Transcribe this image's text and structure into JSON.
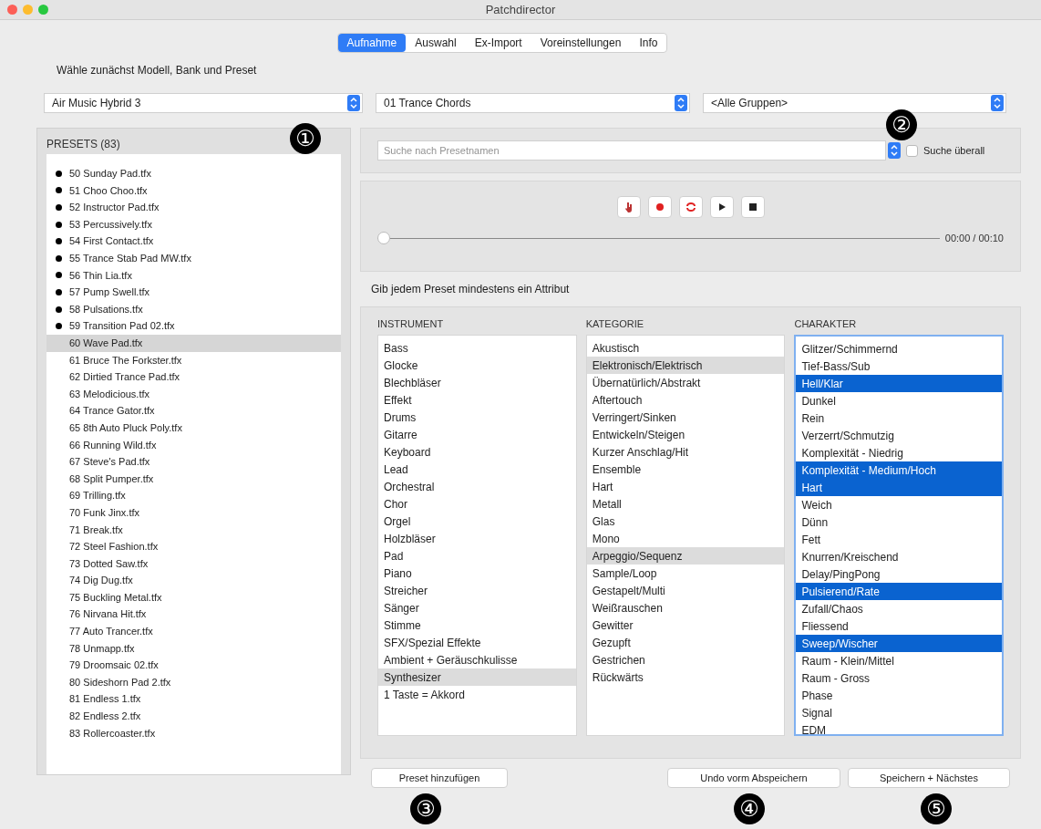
{
  "window": {
    "title": "Patchdirector"
  },
  "tabs": [
    {
      "label": "Aufnahme",
      "selected": true
    },
    {
      "label": "Auswahl",
      "selected": false
    },
    {
      "label": "Ex-Import",
      "selected": false
    },
    {
      "label": "Voreinstellungen",
      "selected": false
    },
    {
      "label": "Info",
      "selected": false
    }
  ],
  "instruction": "Wähle zunächst Modell, Bank und Preset",
  "selectors": [
    "Air Music Hybrid 3",
    "01 Trance Chords",
    "<Alle Gruppen>"
  ],
  "presets": {
    "title": "PRESETS (83)",
    "items": [
      {
        "label": "50 Sunday Pad.tfx",
        "marked": true,
        "selected": false
      },
      {
        "label": "51 Choo Choo.tfx",
        "marked": true,
        "selected": false
      },
      {
        "label": "52 Instructor Pad.tfx",
        "marked": true,
        "selected": false
      },
      {
        "label": "53 Percussively.tfx",
        "marked": true,
        "selected": false
      },
      {
        "label": "54 First Contact.tfx",
        "marked": true,
        "selected": false
      },
      {
        "label": "55 Trance Stab Pad MW.tfx",
        "marked": true,
        "selected": false
      },
      {
        "label": "56 Thin Lia.tfx",
        "marked": true,
        "selected": false
      },
      {
        "label": "57 Pump Swell.tfx",
        "marked": true,
        "selected": false
      },
      {
        "label": "58 Pulsations.tfx",
        "marked": true,
        "selected": false
      },
      {
        "label": "59 Transition Pad 02.tfx",
        "marked": true,
        "selected": false
      },
      {
        "label": "60 Wave Pad.tfx",
        "marked": false,
        "selected": true
      },
      {
        "label": "61 Bruce The Forkster.tfx",
        "marked": false,
        "selected": false
      },
      {
        "label": "62 Dirtied Trance Pad.tfx",
        "marked": false,
        "selected": false
      },
      {
        "label": "63 Melodicious.tfx",
        "marked": false,
        "selected": false
      },
      {
        "label": "64 Trance Gator.tfx",
        "marked": false,
        "selected": false
      },
      {
        "label": "65 8th Auto Pluck Poly.tfx",
        "marked": false,
        "selected": false
      },
      {
        "label": "66 Running Wild.tfx",
        "marked": false,
        "selected": false
      },
      {
        "label": "67 Steve's Pad.tfx",
        "marked": false,
        "selected": false
      },
      {
        "label": "68 Split Pumper.tfx",
        "marked": false,
        "selected": false
      },
      {
        "label": "69 Trilling.tfx",
        "marked": false,
        "selected": false
      },
      {
        "label": "70 Funk Jinx.tfx",
        "marked": false,
        "selected": false
      },
      {
        "label": "71 Break.tfx",
        "marked": false,
        "selected": false
      },
      {
        "label": "72 Steel Fashion.tfx",
        "marked": false,
        "selected": false
      },
      {
        "label": "73 Dotted Saw.tfx",
        "marked": false,
        "selected": false
      },
      {
        "label": "74 Dig Dug.tfx",
        "marked": false,
        "selected": false
      },
      {
        "label": "75 Buckling Metal.tfx",
        "marked": false,
        "selected": false
      },
      {
        "label": "76 Nirvana Hit.tfx",
        "marked": false,
        "selected": false
      },
      {
        "label": "77 Auto Trancer.tfx",
        "marked": false,
        "selected": false
      },
      {
        "label": "78 Unmapp.tfx",
        "marked": false,
        "selected": false
      },
      {
        "label": "79 Droomsaic 02.tfx",
        "marked": false,
        "selected": false
      },
      {
        "label": "80 Sideshorn Pad 2.tfx",
        "marked": false,
        "selected": false
      },
      {
        "label": "81 Endless 1.tfx",
        "marked": false,
        "selected": false
      },
      {
        "label": "82 Endless 2.tfx",
        "marked": false,
        "selected": false
      },
      {
        "label": "83 Rollercoaster.tfx",
        "marked": false,
        "selected": false
      }
    ]
  },
  "search": {
    "placeholder": "Suche nach Presetnamen",
    "everywhere": {
      "label": "Suche überall",
      "checked": false
    }
  },
  "transport": {
    "buttons": [
      {
        "kind": "hand"
      },
      {
        "kind": "record"
      },
      {
        "kind": "loop"
      },
      {
        "kind": "play"
      },
      {
        "kind": "stop"
      }
    ],
    "position": {
      "level": 0
    },
    "time": "00:00 / 00:10"
  },
  "attributes": {
    "hint": "Gib jedem Preset mindestens ein Attribut",
    "columns": [
      {
        "title": "INSTRUMENT",
        "items": [
          {
            "label": "Bass",
            "selected": false
          },
          {
            "label": "Glocke",
            "selected": false
          },
          {
            "label": "Blechbläser",
            "selected": false
          },
          {
            "label": "Effekt",
            "selected": false
          },
          {
            "label": "Drums",
            "selected": false
          },
          {
            "label": "Gitarre",
            "selected": false
          },
          {
            "label": "Keyboard",
            "selected": false
          },
          {
            "label": "Lead",
            "selected": false
          },
          {
            "label": "Orchestral",
            "selected": false
          },
          {
            "label": "Chor",
            "selected": false
          },
          {
            "label": "Orgel",
            "selected": false
          },
          {
            "label": "Holzbläser",
            "selected": false
          },
          {
            "label": "Pad",
            "selected": false
          },
          {
            "label": "Piano",
            "selected": false
          },
          {
            "label": "Streicher",
            "selected": false
          },
          {
            "label": "Sänger",
            "selected": false
          },
          {
            "label": "Stimme",
            "selected": false
          },
          {
            "label": "SFX/Spezial Effekte",
            "selected": false
          },
          {
            "label": "Ambient + Geräuschkulisse",
            "selected": false
          },
          {
            "label": "Synthesizer",
            "selected": true
          },
          {
            "label": "1 Taste = Akkord",
            "selected": false
          }
        ]
      },
      {
        "title": "KATEGORIE",
        "items": [
          {
            "label": "Akustisch",
            "selected": false
          },
          {
            "label": "Elektronisch/Elektrisch",
            "selected": true
          },
          {
            "label": "Übernatürlich/Abstrakt",
            "selected": false
          },
          {
            "label": "Aftertouch",
            "selected": false
          },
          {
            "label": "Verringert/Sinken",
            "selected": false
          },
          {
            "label": "Entwickeln/Steigen",
            "selected": false
          },
          {
            "label": "Kurzer Anschlag/Hit",
            "selected": false
          },
          {
            "label": "Ensemble",
            "selected": false
          },
          {
            "label": "Hart",
            "selected": false
          },
          {
            "label": "Metall",
            "selected": false
          },
          {
            "label": "Glas",
            "selected": false
          },
          {
            "label": "Mono",
            "selected": false
          },
          {
            "label": "Arpeggio/Sequenz",
            "selected": true
          },
          {
            "label": "Sample/Loop",
            "selected": false
          },
          {
            "label": "Gestapelt/Multi",
            "selected": false
          },
          {
            "label": "Weißrauschen",
            "selected": false
          },
          {
            "label": "Gewitter",
            "selected": false
          },
          {
            "label": "Gezupft",
            "selected": false
          },
          {
            "label": "Gestrichen",
            "selected": false
          },
          {
            "label": "Rückwärts",
            "selected": false
          }
        ]
      },
      {
        "title": "CHARAKTER",
        "items": [
          {
            "label": "Glitzer/Schimmernd",
            "selected": false
          },
          {
            "label": "Tief-Bass/Sub",
            "selected": false
          },
          {
            "label": "Hell/Klar",
            "selected": true
          },
          {
            "label": "Dunkel",
            "selected": false
          },
          {
            "label": "Rein",
            "selected": false
          },
          {
            "label": "Verzerrt/Schmutzig",
            "selected": false
          },
          {
            "label": "Komplexität - Niedrig",
            "selected": false
          },
          {
            "label": "Komplexität - Medium/Hoch",
            "selected": true
          },
          {
            "label": "Hart",
            "selected": true
          },
          {
            "label": "Weich",
            "selected": false
          },
          {
            "label": "Dünn",
            "selected": false
          },
          {
            "label": "Fett",
            "selected": false
          },
          {
            "label": "Knurren/Kreischend",
            "selected": false
          },
          {
            "label": "Delay/PingPong",
            "selected": false
          },
          {
            "label": "Pulsierend/Rate",
            "selected": true
          },
          {
            "label": "Zufall/Chaos",
            "selected": false
          },
          {
            "label": "Fliessend",
            "selected": false
          },
          {
            "label": "Sweep/Wischer",
            "selected": true
          },
          {
            "label": "Raum - Klein/Mittel",
            "selected": false
          },
          {
            "label": "Raum - Gross",
            "selected": false
          },
          {
            "label": "Phase",
            "selected": false
          },
          {
            "label": "Signal",
            "selected": false
          },
          {
            "label": "EDM",
            "selected": false
          }
        ]
      }
    ]
  },
  "buttons": [
    "Preset hinzufügen",
    "Undo vorm Abspeichern",
    "Speichern + Nächstes"
  ],
  "callouts": [
    "①",
    "②",
    "③",
    "④",
    "⑤"
  ]
}
